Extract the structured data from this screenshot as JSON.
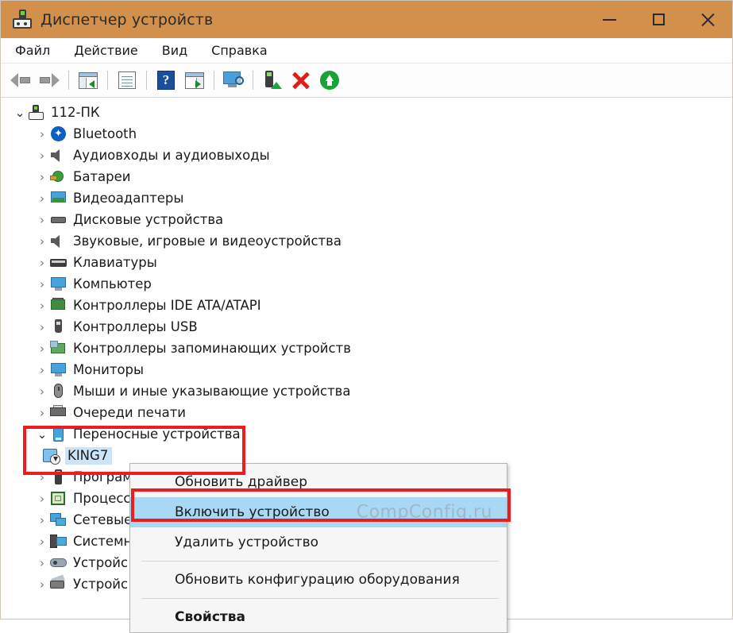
{
  "window": {
    "title": "Диспетчер устройств",
    "title_icon": "device-manager-icon",
    "accent_color": "#d2904b",
    "controls": {
      "minimize": "—",
      "maximize": "□",
      "close": "✕"
    }
  },
  "menubar": {
    "items": [
      {
        "label": "Файл",
        "name": "menu-file"
      },
      {
        "label": "Действие",
        "name": "menu-action"
      },
      {
        "label": "Вид",
        "name": "menu-view"
      },
      {
        "label": "Справка",
        "name": "menu-help"
      }
    ]
  },
  "toolbar": {
    "buttons": [
      {
        "name": "back-button",
        "icon": "arrow-left-icon"
      },
      {
        "name": "forward-button",
        "icon": "arrow-right-icon"
      },
      {
        "name": "show-hide-console-tree-button",
        "icon": "console-tree-icon"
      },
      {
        "name": "properties-button",
        "icon": "properties-document-icon"
      },
      {
        "name": "help-button",
        "icon": "question-mark-icon"
      },
      {
        "name": "show-hide-action-pane-button",
        "icon": "action-pane-icon"
      },
      {
        "name": "scan-hardware-changes-button",
        "icon": "monitor-scan-icon"
      },
      {
        "name": "update-driver-button",
        "icon": "update-driver-icon"
      },
      {
        "name": "uninstall-device-button",
        "icon": "red-x-icon"
      },
      {
        "name": "enable-device-button",
        "icon": "green-up-arrow-icon"
      }
    ]
  },
  "tree": {
    "root": {
      "label": "112-ПК",
      "icon": "computer-icon",
      "expanded": true
    },
    "nodes": [
      {
        "label": "Bluetooth",
        "icon": "bluetooth-icon",
        "expanded": false
      },
      {
        "label": "Аудиовходы и аудиовыходы",
        "icon": "audio-icon",
        "expanded": false
      },
      {
        "label": "Батареи",
        "icon": "battery-icon",
        "expanded": false
      },
      {
        "label": "Видеоадаптеры",
        "icon": "display-adapter-icon",
        "expanded": false
      },
      {
        "label": "Дисковые устройства",
        "icon": "disk-drive-icon",
        "expanded": false
      },
      {
        "label": "Звуковые, игровые и видеоустройства",
        "icon": "sound-video-icon",
        "expanded": false
      },
      {
        "label": "Клавиатуры",
        "icon": "keyboard-icon",
        "expanded": false
      },
      {
        "label": "Компьютер",
        "icon": "monitor-icon",
        "expanded": false
      },
      {
        "label": "Контроллеры IDE ATA/ATAPI",
        "icon": "ide-controller-icon",
        "expanded": false
      },
      {
        "label": "Контроллеры USB",
        "icon": "usb-icon",
        "expanded": false
      },
      {
        "label": "Контроллеры запоминающих устройств",
        "icon": "storage-controller-icon",
        "expanded": false
      },
      {
        "label": "Мониторы",
        "icon": "monitor-icon",
        "expanded": false
      },
      {
        "label": "Мыши и иные указывающие устройства",
        "icon": "mouse-icon",
        "expanded": false
      },
      {
        "label": "Очереди печати",
        "icon": "printer-icon",
        "expanded": false
      },
      {
        "label": "Переносные устройства",
        "icon": "portable-device-icon",
        "expanded": true
      },
      {
        "label": "Програм",
        "icon": "software-device-icon",
        "expanded": false
      },
      {
        "label": "Процесс",
        "icon": "processor-icon",
        "expanded": false
      },
      {
        "label": "Сетевые",
        "icon": "network-adapter-icon",
        "expanded": false
      },
      {
        "label": "Системн",
        "icon": "system-device-icon",
        "expanded": false
      },
      {
        "label": "Устройс",
        "icon": "hid-device-icon",
        "expanded": false
      },
      {
        "label": "Устройс",
        "icon": "imaging-device-icon",
        "expanded": false
      }
    ],
    "child_device": {
      "label": "KING7",
      "icon": "portable-device-disabled-icon",
      "selected": true
    }
  },
  "context_menu": {
    "items": [
      {
        "label": "Обновить драйвер",
        "name": "ctx-update-driver",
        "highlighted": false,
        "bold": false
      },
      {
        "label": "Включить устройство",
        "name": "ctx-enable-device",
        "highlighted": true,
        "bold": false
      },
      {
        "label": "Удалить устройство",
        "name": "ctx-uninstall-device",
        "highlighted": false,
        "bold": false
      },
      {
        "label": "Обновить конфигурацию оборудования",
        "name": "ctx-scan-hardware",
        "highlighted": false,
        "bold": false
      },
      {
        "label": "Свойства",
        "name": "ctx-properties",
        "highlighted": false,
        "bold": true
      }
    ],
    "highlight_color": "#a8d8f4"
  },
  "watermark": {
    "text": "CompConfig.ru",
    "color": "#9fb6cb"
  },
  "annotations": {
    "highlight_color": "#ee1c1c",
    "boxes": [
      {
        "name": "tree-highlight-box",
        "target": "Переносные устройства / KING7"
      },
      {
        "name": "menu-highlight-box",
        "target": "Включить устройство"
      }
    ]
  }
}
